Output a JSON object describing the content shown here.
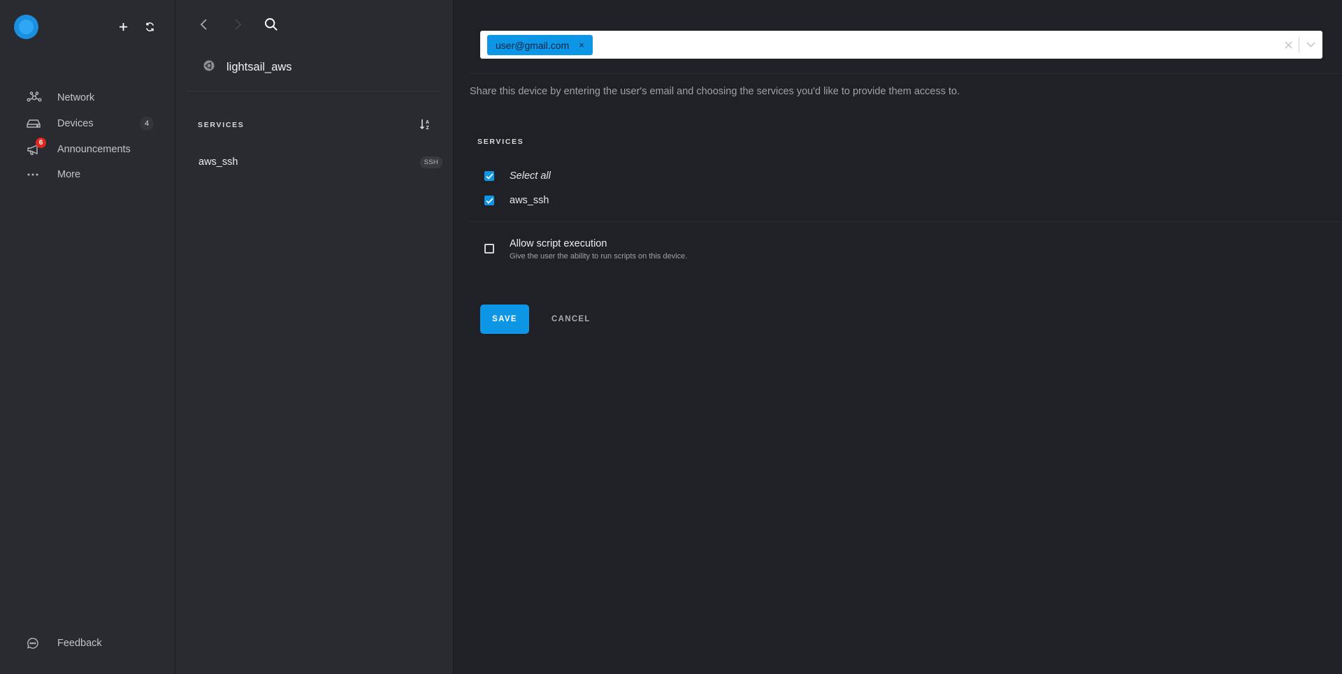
{
  "sidebar": {
    "nav": [
      {
        "label": "Network"
      },
      {
        "label": "Devices",
        "count": "4"
      },
      {
        "label": "Announcements",
        "badge": "6"
      },
      {
        "label": "More"
      }
    ],
    "feedback_label": "Feedback"
  },
  "device": {
    "name": "lightsail_aws",
    "services_title": "SERVICES",
    "services": [
      {
        "name": "aws_ssh",
        "type": "SSH"
      }
    ]
  },
  "share": {
    "email_chip": "user@gmail.com",
    "chip_remove": "×",
    "description": "Share this device by entering the user's email and choosing the services you'd like to provide them access to.",
    "services_title": "SERVICES",
    "select_all_label": "Select all",
    "service_label": "aws_ssh",
    "allow_title": "Allow script execution",
    "allow_subtitle": "Give the user the ability to run scripts on this device.",
    "save_label": "SAVE",
    "cancel_label": "CANCEL"
  },
  "colors": {
    "accent": "#0e96e6",
    "badge_red": "#e2261d",
    "sidebar_bg": "#2a2b31",
    "main_bg": "#202126"
  },
  "icons": [
    "logo-icon",
    "plus-icon",
    "refresh-icon",
    "network-icon",
    "devices-icon",
    "megaphone-icon",
    "more-icon",
    "feedback-icon",
    "back-icon",
    "forward-icon",
    "search-icon",
    "device-type-icon",
    "sort-alpha-icon",
    "clear-icon",
    "chevron-down-icon",
    "checkbox-icon"
  ]
}
